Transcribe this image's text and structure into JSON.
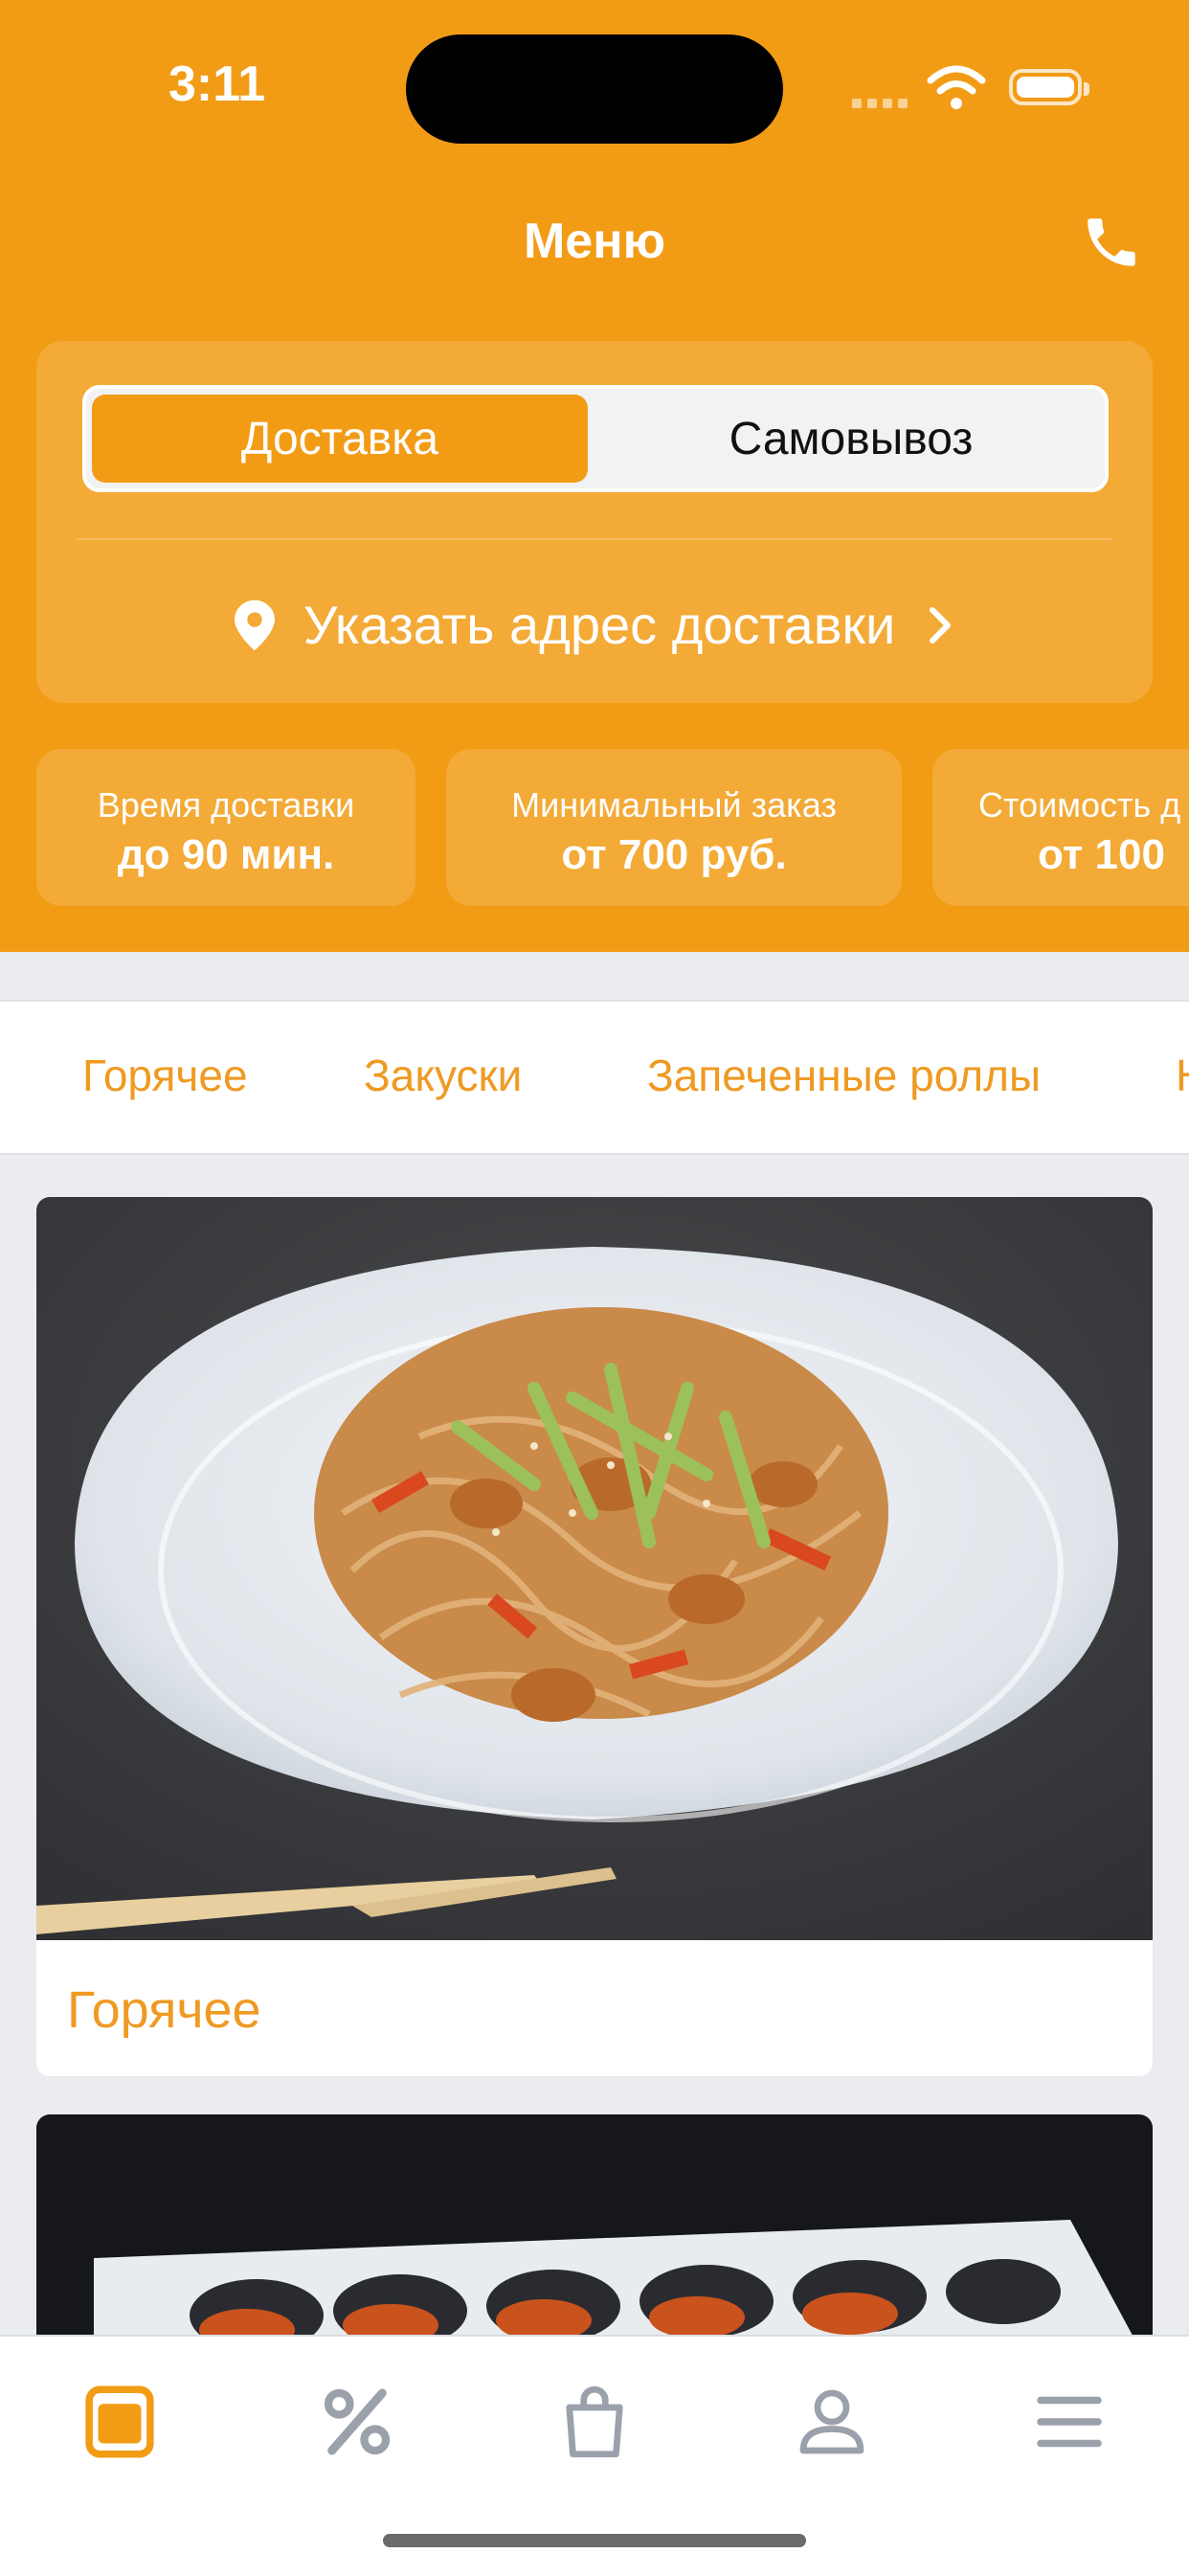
{
  "status_bar": {
    "time": "3:11"
  },
  "header": {
    "title": "Меню",
    "phone_icon": "phone-icon"
  },
  "delivery_mode": {
    "options": [
      "Доставка",
      "Самовывоз"
    ],
    "selected": "Доставка"
  },
  "address": {
    "label": "Указать адрес доставки"
  },
  "info_cards": [
    {
      "label": "Время доставки",
      "value": "до 90 мин."
    },
    {
      "label": "Минимальный заказ",
      "value": "от 700 руб."
    },
    {
      "label": "Стоимость д",
      "value": "от 100"
    }
  ],
  "category_tabs": [
    "Горячее",
    "Закуски",
    "Запеченные роллы",
    "Н"
  ],
  "categories": [
    {
      "name": "Горячее",
      "image": "noodles-with-chicken-photo"
    },
    {
      "name": "",
      "image": "baked-mussels-photo"
    }
  ],
  "bottom_nav": [
    "menu-icon",
    "percent-icon",
    "bag-icon",
    "profile-icon",
    "hamburger-icon"
  ],
  "colors": {
    "accent": "#f29c16",
    "accent_text": "#ef9a22",
    "inactive_icon": "#9aa1ab"
  }
}
